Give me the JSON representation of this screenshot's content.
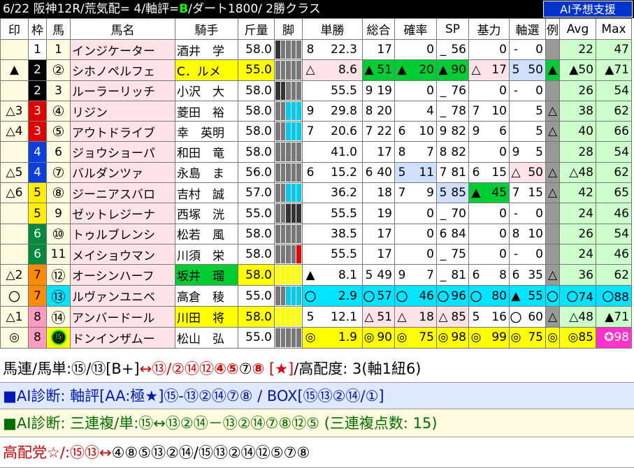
{
  "header": {
    "race": "6/22 阪神12R/荒気配= 4/軸評=",
    "grade": "B",
    "rest": "/ダート1800/ 2勝クラス",
    "ai_button": "AI予想支援"
  },
  "columns": [
    "印",
    "枠",
    "馬",
    "馬名",
    "騎手",
    "斤量",
    "脚",
    "単勝",
    "総合",
    "確率",
    "SP",
    "基力",
    "軸選",
    "例",
    "Avg",
    "Max"
  ],
  "colors": {
    "black": "#000000",
    "header_text": "#ffffff",
    "ai_button": "#0033cc",
    "green_mark": "#00cc33",
    "cyan": "#00e5ff",
    "yellow": "#ffff00",
    "magenta": "#ff33cc"
  },
  "horses": [
    {
      "mark": "",
      "waku": "1",
      "uma": "1",
      "name": "インジケーター",
      "jockey": "酒井　学",
      "kinryo": "58.0",
      "tanmark": "8",
      "odds": "22.3",
      "sm": "",
      "sogo": "17",
      "km": "",
      "kakuritsu": "0",
      "spm": "_",
      "sp": "56",
      "kimark": "",
      "kiryoku": "0",
      "ax": "-",
      "axv": "0",
      "rei": "",
      "avg": "22",
      "max": "47"
    },
    {
      "mark": "▲",
      "waku": "2",
      "uma": "2",
      "name": "シホノペルフェ",
      "jockey": "C．ルメ",
      "kinryo": "55.0",
      "tanmark": "△",
      "odds": "8.6",
      "sm": "▲",
      "sogo": "51",
      "km": "▲",
      "kakuritsu": "20",
      "spm": "▲",
      "sp": "90",
      "kimark": "△",
      "kiryoku": "17",
      "ax": "5",
      "axv": "50",
      "rei": "▲",
      "avg": "▲50",
      "max": "▲71"
    },
    {
      "mark": "",
      "waku": "2",
      "uma": "3",
      "name": "ルーラーリッチ",
      "jockey": "小沢　大",
      "kinryo": "58.0",
      "tanmark": "",
      "odds": "55.5",
      "sm": "9",
      "sogo": "19",
      "km": "",
      "kakuritsu": "0",
      "spm": "_",
      "sp": "76",
      "kimark": "",
      "kiryoku": "0",
      "ax": "-",
      "axv": "0",
      "rei": "",
      "avg": "26",
      "max": "54"
    },
    {
      "mark": "△3",
      "waku": "3",
      "uma": "4",
      "name": "リジン",
      "jockey": "菱田　裕",
      "kinryo": "58.0",
      "tanmark": "9",
      "odds": "29.8",
      "sm": "8",
      "sogo": "20",
      "km": "",
      "kakuritsu": "4",
      "spm": "_",
      "sp": "78",
      "kimark": "7",
      "kiryoku": "10",
      "ax": "",
      "axv": "5",
      "rei": "△",
      "avg": "38",
      "max": "62"
    },
    {
      "mark": "△4",
      "waku": "3",
      "uma": "5",
      "name": "アウトドライブ",
      "jockey": "幸　英明",
      "kinryo": "58.0",
      "tanmark": "7",
      "odds": "20.6",
      "sm": "7",
      "sogo": "22",
      "km": "6",
      "kakuritsu": "10",
      "spm": "9",
      "sp": "82",
      "kimark": "9",
      "kiryoku": "6",
      "ax": "",
      "axv": "5",
      "rei": "△",
      "avg": "40",
      "max": "66"
    },
    {
      "mark": "",
      "waku": "4",
      "uma": "6",
      "name": "ジョウショーパ",
      "jockey": "和田　竜",
      "kinryo": "58.0",
      "tanmark": "",
      "odds": "41.0",
      "sm": "",
      "sogo": "17",
      "km": "8",
      "kakuritsu": "7",
      "spm": "8",
      "sp": "82",
      "kimark": "",
      "kiryoku": "0",
      "ax": "9",
      "axv": "5",
      "rei": "",
      "avg": "28",
      "max": "54"
    },
    {
      "mark": "△5",
      "waku": "4",
      "uma": "7",
      "name": "バルダンツァ",
      "jockey": "永島　ま",
      "kinryo": "56.0",
      "tanmark": "6",
      "odds": "15.2",
      "sm": "6",
      "sogo": "40",
      "km": "5",
      "kakuritsu": "11",
      "spm": "7",
      "sp": "81",
      "kimark": "6",
      "kiryoku": "15",
      "ax": "△",
      "axv": "50",
      "rei": "△",
      "avg": "△48",
      "max": "62"
    },
    {
      "mark": "△6",
      "waku": "5",
      "uma": "8",
      "name": "ジーニアスバロ",
      "jockey": "吉村　誠",
      "kinryo": "57.0",
      "tanmark": "",
      "odds": "36.2",
      "sm": "",
      "sogo": "18",
      "km": "7",
      "kakuritsu": "9",
      "spm": "5",
      "sp": "85",
      "kimark": "▲",
      "kiryoku": "45",
      "ax": "7",
      "axv": "15",
      "rei": "△",
      "avg": "42",
      "max": "65"
    },
    {
      "mark": "",
      "waku": "5",
      "uma": "9",
      "name": "ゼットレジーナ",
      "jockey": "西塚　洸",
      "kinryo": "55.0",
      "tanmark": "",
      "odds": "55.5",
      "sm": "",
      "sogo": "19",
      "km": "",
      "kakuritsu": "0",
      "spm": "_",
      "sp": "70",
      "kimark": "",
      "kiryoku": "0",
      "ax": "-",
      "axv": "0",
      "rei": "",
      "avg": "24",
      "max": "46"
    },
    {
      "mark": "",
      "waku": "6",
      "uma": "10",
      "name": "トゥルブレンシ",
      "jockey": "松若　風",
      "kinryo": "58.0",
      "tanmark": "",
      "odds": "38.5",
      "sm": "",
      "sogo": "17",
      "km": "",
      "kakuritsu": "0",
      "spm": "6",
      "sp": "84",
      "kimark": "",
      "kiryoku": "0",
      "ax": "8",
      "axv": "10",
      "rei": "",
      "avg": "26",
      "max": "54"
    },
    {
      "mark": "",
      "waku": "6",
      "uma": "11",
      "name": "メイショウマン",
      "jockey": "川須　栄",
      "kinryo": "58.0",
      "tanmark": "",
      "odds": "55.5",
      "sm": "",
      "sogo": "17",
      "km": "",
      "kakuritsu": "0",
      "spm": "_",
      "sp": "75",
      "kimark": "",
      "kiryoku": "0",
      "ax": "-",
      "axv": "0",
      "rei": "",
      "avg": "24",
      "max": "46"
    },
    {
      "mark": "△2",
      "waku": "7",
      "uma": "12",
      "name": "オーシンハーフ",
      "jockey": "坂井　瑠",
      "kinryo": "58.0",
      "tanmark": "▲",
      "odds": "8.1",
      "sm": "5",
      "sogo": "49",
      "km": "9",
      "kakuritsu": "7",
      "spm": "_",
      "sp": "81",
      "kimark": "6",
      "kiryoku": "8",
      "ax": "6",
      "axv": "35",
      "rei": "△",
      "avg": "36",
      "max": "62"
    },
    {
      "mark": "〇",
      "waku": "7",
      "uma": "13",
      "name": "ルヴァンユニベ",
      "jockey": "高倉　稜",
      "kinryo": "55.0",
      "tanmark": "〇",
      "odds": "2.9",
      "sm": "〇",
      "sogo": "57",
      "km": "〇",
      "kakuritsu": "46",
      "spm": "〇",
      "sp": "96",
      "kimark": "〇",
      "kiryoku": "80",
      "ax": "▲",
      "axv": "55",
      "rei": "〇",
      "avg": "〇74",
      "max": "〇88"
    },
    {
      "mark": "△1",
      "waku": "8",
      "uma": "14",
      "name": "アンバードール",
      "jockey": "川田　将",
      "kinryo": "58.0",
      "tanmark": "5",
      "odds": "12.1",
      "sm": "△",
      "sogo": "51",
      "km": "△",
      "kakuritsu": "18",
      "spm": "△",
      "sp": "85",
      "kimark": "5",
      "kiryoku": "16",
      "ax": "〇",
      "axv": "60",
      "rei": "△",
      "avg": "△48",
      "max": "▲71"
    },
    {
      "mark": "◎",
      "waku": "8",
      "uma": "15",
      "name": "ドンインザムー",
      "jockey": "松山　弘",
      "kinryo": "55.0",
      "tanmark": "◎",
      "odds": "1.9",
      "sm": "◎",
      "sogo": "90",
      "km": "◎",
      "kakuritsu": "75",
      "spm": "◎",
      "sp": "98",
      "kimark": "◎",
      "kiryoku": "99",
      "ax": "◎",
      "axv": "75",
      "rei": "◎",
      "avg": "◎85",
      "max": "✪98"
    }
  ],
  "summary": {
    "line1_a": "馬連/馬単:⑮/⑬[B+]",
    "line1_b": "↔⑬/②⑭⑫",
    "line1_c": "④⑤",
    "line1_d": "⑦",
    "line1_e": "⑧",
    "line1_f": "[★]",
    "line1_g": "/高配度: 3(軸1紐6)",
    "line2": "■AI診断: 軸評[AA:極★]⑮-⑬②⑭⑦⑧ / BOX[⑮⑬②⑭/①]",
    "line3": "■AI診断: 三連複/単:⑮↔⑬②⑭－⑬②⑭⑦⑧⑫⑤ (三連複点数: 15)",
    "line4_a": "高配党☆/:⑮⑬",
    "line4_b": "↔",
    "line4_c": "④⑧⑤⑬②⑭/⑮⑬②⑭⑫⑤⑦⑧"
  }
}
